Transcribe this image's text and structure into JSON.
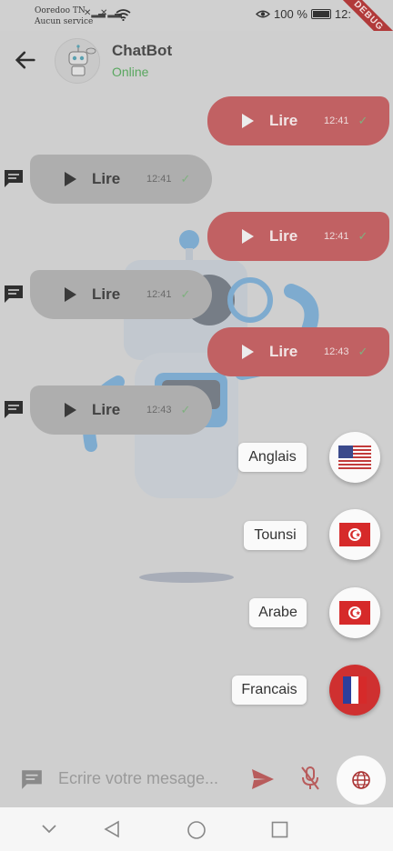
{
  "status": {
    "carrier_line1": "Ooredoo TN",
    "carrier_line2": "Aucun service",
    "battery": "100 %",
    "time_partial": "12:",
    "debug_banner": "DEBUG"
  },
  "header": {
    "title": "ChatBot",
    "status": "Online"
  },
  "messages": [
    {
      "side": "sent",
      "label": "Lire",
      "time": "12:41"
    },
    {
      "side": "recv",
      "label": "Lire",
      "time": "12:41"
    },
    {
      "side": "sent",
      "label": "Lire",
      "time": "12:41"
    },
    {
      "side": "recv",
      "label": "Lire",
      "time": "12:41"
    },
    {
      "side": "sent",
      "label": "Lire",
      "time": "12:43"
    },
    {
      "side": "recv",
      "label": "Lire",
      "time": "12:43"
    }
  ],
  "languages": [
    {
      "label": "Anglais",
      "flag": "usa-flag"
    },
    {
      "label": "Tounsi",
      "flag": "tunisia-flag"
    },
    {
      "label": "Arabe",
      "flag": "tunisia-flag"
    },
    {
      "label": "Francais",
      "flag": "france-flag"
    }
  ],
  "input": {
    "placeholder": "Ecrire votre mesage..."
  },
  "colors": {
    "sent_bubble": "#c16163",
    "recv_bubble": "#aeaeae",
    "online_green": "#5aa760",
    "french_red": "#cf3030"
  }
}
